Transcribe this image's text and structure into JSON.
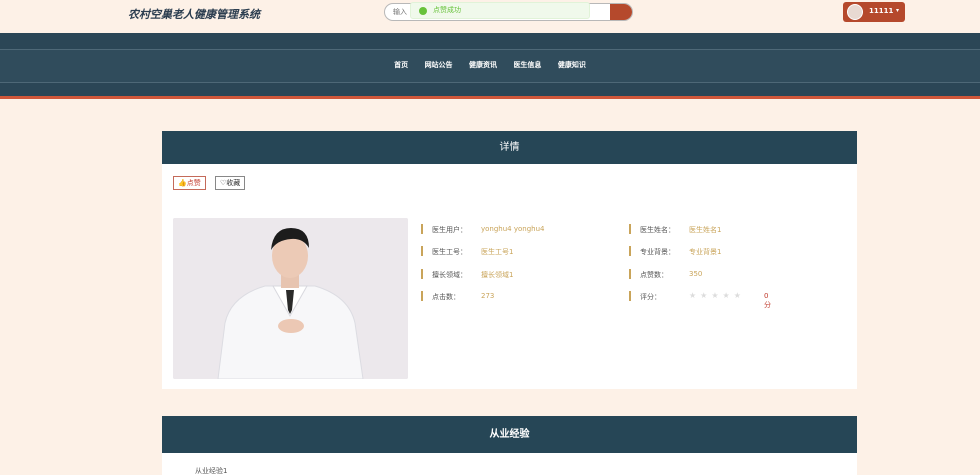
{
  "header": {
    "site_title": "农村空巢老人健康管理系统",
    "search_placeholder": "输入",
    "toast": "点赞成功",
    "user_name": "11111",
    "caret": "▾"
  },
  "nav": {
    "items": [
      "首页",
      "网站公告",
      "健康资讯",
      "医生信息",
      "健康知识"
    ]
  },
  "detail": {
    "title": "详情",
    "like_label": "👍点赞",
    "fav_label": "♡收藏",
    "fields": {
      "account": {
        "label": "医生用户：",
        "value": "yonghu4 yonghu4"
      },
      "name": {
        "label": "医生姓名：",
        "value": "医生姓名1"
      },
      "employee_no": {
        "label": "医生工号：",
        "value": "医生工号1"
      },
      "background": {
        "label": "专业背景：",
        "value": "专业背景1"
      },
      "specialty": {
        "label": "擅长领域：",
        "value": "擅长领域1"
      },
      "likes": {
        "label": "点赞数：",
        "value": "350"
      },
      "clicks": {
        "label": "点击数：",
        "value": "273"
      },
      "rating": {
        "label": "评分：",
        "stars": "★★★★★",
        "score": "0分"
      }
    }
  },
  "experience": {
    "title": "从业经验",
    "body": "从业经验1"
  },
  "colors": {
    "nav_bg": "#2b4656",
    "accent": "#b5492c",
    "panel_head": "#264656",
    "value_text": "#c9a45a"
  }
}
